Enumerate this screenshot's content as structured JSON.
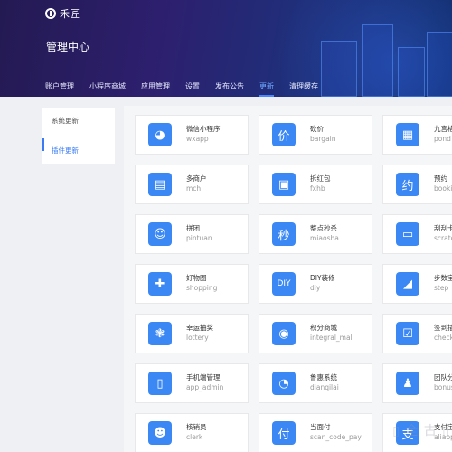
{
  "app": {
    "logo_text": "禾匠",
    "title": "管理中心"
  },
  "nav": [
    {
      "label": "账户管理"
    },
    {
      "label": "小程序商城"
    },
    {
      "label": "应用管理"
    },
    {
      "label": "设置"
    },
    {
      "label": "发布公告"
    },
    {
      "label": "更新",
      "active": true
    },
    {
      "label": "清理缓存"
    }
  ],
  "sidebar": [
    {
      "label": "系统更新"
    },
    {
      "label": "插件更新",
      "active": true
    }
  ],
  "plugins": [
    [
      {
        "name": "微信小程序",
        "code": "wxapp",
        "icon": "wechat-icon",
        "glyph": "◕"
      },
      {
        "name": "砍价",
        "code": "bargain",
        "icon": "bargain-icon",
        "glyph": "价"
      },
      {
        "name": "九宫格",
        "code": "pond",
        "icon": "grid-icon",
        "glyph": "▦"
      }
    ],
    [
      {
        "name": "多商户",
        "code": "mch",
        "icon": "shop-icon",
        "glyph": "▤"
      },
      {
        "name": "拆红包",
        "code": "fxhb",
        "icon": "red-packet-icon",
        "glyph": "▣"
      },
      {
        "name": "预约",
        "code": "booking",
        "icon": "booking-icon",
        "glyph": "约"
      }
    ],
    [
      {
        "name": "拼团",
        "code": "pintuan",
        "icon": "group-buy-icon",
        "glyph": "☺"
      },
      {
        "name": "整点秒杀",
        "code": "miaosha",
        "icon": "flash-sale-icon",
        "glyph": "秒"
      },
      {
        "name": "刮刮卡",
        "code": "scratch",
        "icon": "scratch-card-icon",
        "glyph": "▭"
      }
    ],
    [
      {
        "name": "好物圈",
        "code": "shopping",
        "icon": "thumb-up-icon",
        "glyph": "✚"
      },
      {
        "name": "DIY装修",
        "code": "diy",
        "icon": "diy-icon",
        "glyph": "DIY"
      },
      {
        "name": "步数宝",
        "code": "step",
        "icon": "shoe-icon",
        "glyph": "◢"
      }
    ],
    [
      {
        "name": "幸运抽奖",
        "code": "lottery",
        "icon": "lottery-icon",
        "glyph": "❃"
      },
      {
        "name": "积分商城",
        "code": "integral_mall",
        "icon": "points-icon",
        "glyph": "◉"
      },
      {
        "name": "签到插件",
        "code": "check_in",
        "icon": "checkin-icon",
        "glyph": "☑"
      }
    ],
    [
      {
        "name": "手机端管理",
        "code": "app_admin",
        "icon": "phone-icon",
        "glyph": "▯"
      },
      {
        "name": "鲁惠系统",
        "code": "dianqilai",
        "icon": "service-icon",
        "glyph": "◔"
      },
      {
        "name": "团队分红",
        "code": "bonus",
        "icon": "team-bonus-icon",
        "glyph": "♟"
      }
    ],
    [
      {
        "name": "核销员",
        "code": "clerk",
        "icon": "clerk-icon",
        "glyph": "☻"
      },
      {
        "name": "当面付",
        "code": "scan_code_pay",
        "icon": "pay-icon",
        "glyph": "付"
      },
      {
        "name": "支付宝小程",
        "code": "aliapp",
        "icon": "alipay-icon",
        "glyph": "支"
      }
    ]
  ]
}
